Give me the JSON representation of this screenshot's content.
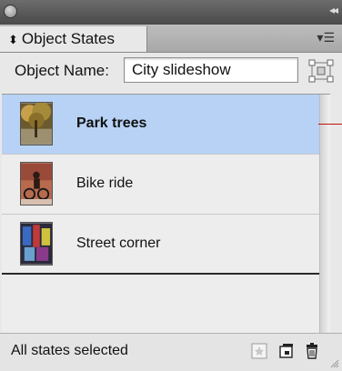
{
  "panel": {
    "tab_label": "Object States",
    "tab_arrows": "⬍"
  },
  "object_name": {
    "label": "Object Name:",
    "value": "City slideshow"
  },
  "states": [
    {
      "label": "Park trees",
      "selected": true
    },
    {
      "label": "Bike ride",
      "selected": false
    },
    {
      "label": "Street corner",
      "selected": false
    }
  ],
  "footer": {
    "status": "All states selected"
  },
  "colors": {
    "selection": "#b7d2f5",
    "callout_line": "#c21010"
  },
  "icons": [
    "panel-close-icon",
    "collapse-icon",
    "panel-menu-icon",
    "select-object-icon",
    "convert-to-button-icon",
    "new-state-icon",
    "delete-state-icon",
    "resize-grip-icon"
  ]
}
